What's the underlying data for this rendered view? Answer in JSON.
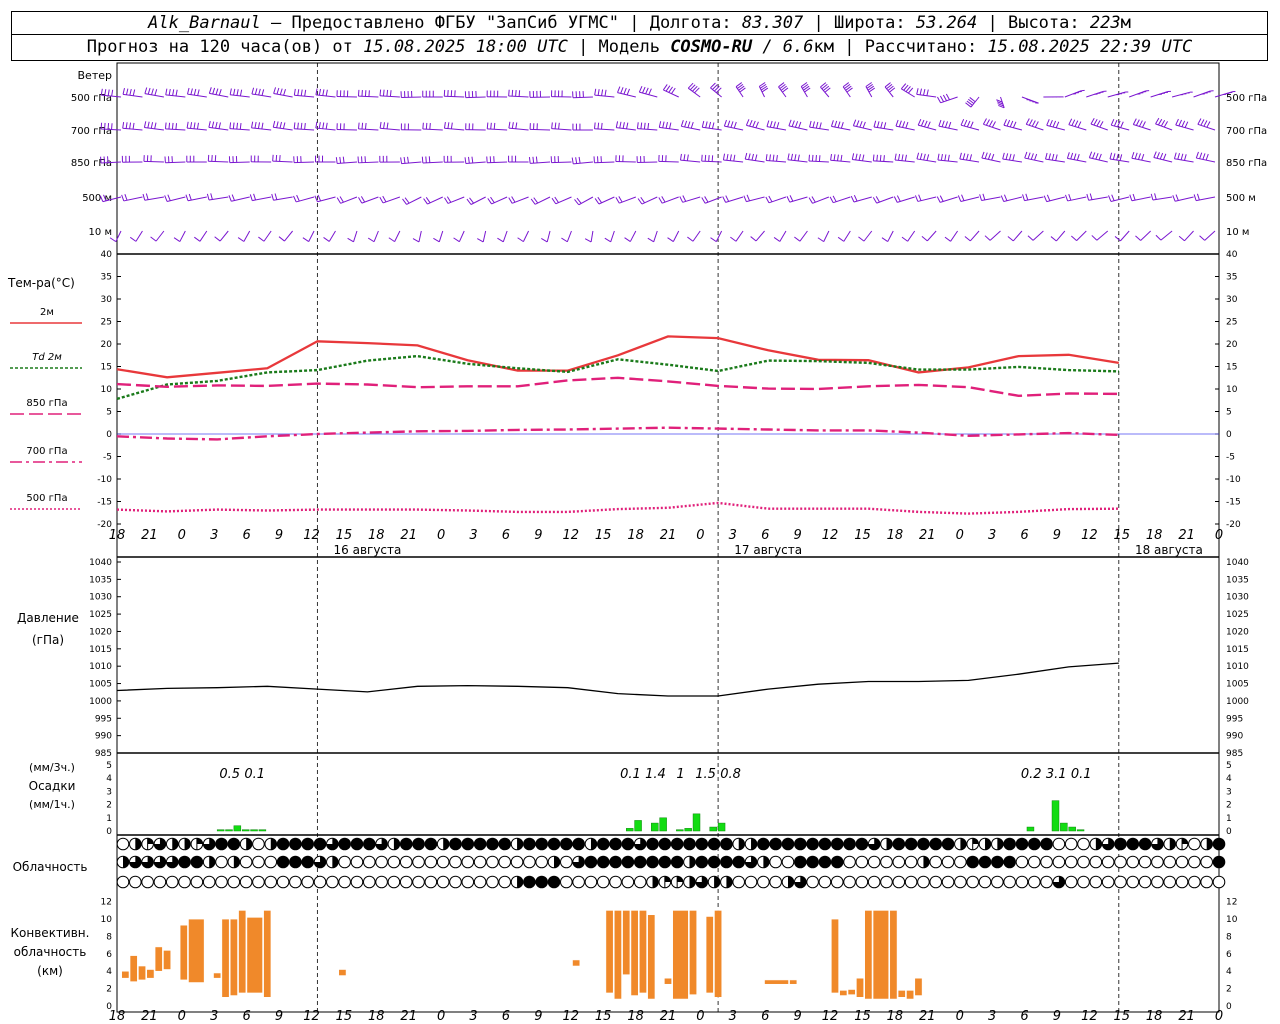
{
  "header": {
    "line1": {
      "station": "Alk_Barnaul",
      "dash": " — ",
      "provider": "Предоставлено ФГБУ \"ЗапСиб УГМС\"",
      "lon_label": " | Долгота: ",
      "lon": "83.307",
      "lat_label": " | Широта: ",
      "lat": "53.264",
      "alt_label": " | Высота: ",
      "alt": "223",
      "alt_unit": "м"
    },
    "line2": {
      "fc_label": "Прогноз на 120 часа(ов) от ",
      "fc_time": "15.08.2025 18:00 UTC",
      "model_label": "  | Модель ",
      "model": "COSMO-RU",
      "model_res": " / 6.6",
      "model_unit": "км",
      "calc_label": " | Рассчитано: ",
      "calc_time": "15.08.2025 22:39 UTC"
    }
  },
  "chart_data": {
    "type": "meteogram",
    "time_ticks": [
      "18",
      "21",
      "0",
      "3",
      "6",
      "9",
      "12",
      "15",
      "18",
      "21",
      "0",
      "3",
      "6",
      "9",
      "12",
      "15",
      "18",
      "21",
      "0",
      "3",
      "6",
      "9",
      "12",
      "15",
      "18",
      "21",
      "0",
      "3",
      "6",
      "9",
      "12",
      "15",
      "18",
      "21",
      "0"
    ],
    "day_labels": [
      {
        "label": "16 августа",
        "at_hours": 30
      },
      {
        "label": "17 августа",
        "at_hours": 78
      },
      {
        "label": "18 августа",
        "at_hours": 126
      }
    ],
    "wind": {
      "title": "Ветер",
      "levels": [
        "500 гПа",
        "700 гПа",
        "850 гПа",
        "500 м",
        "10 м"
      ],
      "samples": [
        {
          "dir": [
            285,
            285,
            270,
            270,
            340,
            340,
            60,
            60
          ],
          "spd": [
            20,
            20,
            22,
            22,
            22,
            22,
            22,
            22
          ]
        },
        {
          "dir": [
            280,
            280,
            275,
            275,
            290,
            290,
            300,
            300
          ],
          "spd": [
            18,
            18,
            17,
            17,
            20,
            20,
            23,
            23
          ]
        },
        {
          "dir": [
            270,
            270,
            265,
            265,
            280,
            280,
            290,
            290
          ],
          "spd": [
            17,
            17,
            16,
            16,
            18,
            18,
            20,
            20
          ]
        },
        {
          "dir": [
            250,
            250,
            230,
            230,
            240,
            240,
            250,
            250
          ],
          "spd": [
            10,
            10,
            9,
            9,
            9,
            9,
            10,
            10
          ]
        },
        {
          "dir": [
            200,
            200,
            190,
            190,
            200,
            200,
            210,
            210
          ],
          "spd": [
            5,
            5,
            5,
            5,
            5,
            5,
            5,
            5
          ]
        }
      ]
    },
    "temperature": {
      "title": "Тем-ра(°C)",
      "ylim": [
        -20,
        40
      ],
      "ticks": [
        -20,
        -15,
        -10,
        -5,
        0,
        5,
        10,
        15,
        20,
        25,
        30,
        35,
        40
      ],
      "hours": [
        0,
        6,
        12,
        18,
        24,
        30,
        36,
        42,
        48,
        54,
        60,
        66,
        72,
        78,
        84,
        90,
        96,
        102,
        108,
        114,
        120
      ],
      "series": [
        {
          "name": "2м",
          "color": "#e8383b",
          "style": "solid",
          "values": [
            14.4,
            12.6,
            13.6,
            14.6,
            20.6,
            20.2,
            19.7,
            16.4,
            14.1,
            14.1,
            17.5,
            21.7,
            21.3,
            18.6,
            16.5,
            16.4,
            13.7,
            14.8,
            17.3,
            17.6,
            15.8
          ]
        },
        {
          "name": "Td 2м",
          "color": "#1a7a1a",
          "style": "short-dash",
          "values": [
            7.8,
            11.0,
            11.8,
            13.7,
            14.2,
            16.3,
            17.3,
            15.6,
            14.6,
            13.8,
            16.6,
            15.4,
            14.0,
            16.3,
            16.2,
            15.8,
            14.3,
            14.3,
            14.9,
            14.2,
            13.9
          ]
        },
        {
          "name": "850 гПа",
          "color": "#e0207a",
          "style": "long-dash",
          "values": [
            11.1,
            10.5,
            10.8,
            10.7,
            11.2,
            11.0,
            10.4,
            10.6,
            10.6,
            11.9,
            12.5,
            11.7,
            10.7,
            10.1,
            10.0,
            10.6,
            10.9,
            10.4,
            8.5,
            9.0,
            8.9
          ]
        },
        {
          "name": "700 гПа",
          "color": "#e0207a",
          "style": "dash-dot",
          "values": [
            -0.5,
            -1.0,
            -1.2,
            -0.5,
            0.0,
            0.3,
            0.6,
            0.7,
            0.9,
            1.0,
            1.2,
            1.4,
            1.2,
            1.0,
            0.8,
            0.8,
            0.3,
            -0.4,
            -0.1,
            0.2,
            -0.2
          ]
        },
        {
          "name": "500 гПа",
          "color": "#e0207a",
          "style": "dotted",
          "values": [
            -16.8,
            -17.2,
            -16.8,
            -17.0,
            -16.8,
            -16.8,
            -16.8,
            -17.0,
            -17.3,
            -17.3,
            -16.7,
            -16.4,
            -15.3,
            -16.6,
            -16.6,
            -16.6,
            -17.3,
            -17.7,
            -17.3,
            -16.7,
            -16.6
          ]
        }
      ]
    },
    "pressure": {
      "title": "Давление",
      "unit": "(гПа)",
      "ylim": [
        985,
        1040
      ],
      "ticks": [
        985,
        990,
        995,
        1000,
        1005,
        1010,
        1015,
        1020,
        1025,
        1030,
        1035,
        1040
      ],
      "hours": [
        0,
        6,
        12,
        18,
        24,
        30,
        36,
        42,
        48,
        54,
        60,
        66,
        72,
        78,
        84,
        90,
        96,
        102,
        108,
        114,
        120
      ],
      "values": [
        1003.0,
        1003.6,
        1003.8,
        1004.2,
        1003.4,
        1002.6,
        1004.2,
        1004.4,
        1004.2,
        1003.8,
        1002.1,
        1001.4,
        1001.4,
        1003.4,
        1004.8,
        1005.6,
        1005.6,
        1005.9,
        1007.7,
        1009.8,
        1010.9
      ]
    },
    "precipitation": {
      "title": "Осадки",
      "unit_top": "(мм/3ч.)",
      "unit_bottom": "(мм/1ч.)",
      "ylim": [
        0,
        5
      ],
      "ticks": [
        0,
        1,
        2,
        3,
        4,
        5
      ],
      "color": "#12dc12",
      "amounts_3h": [
        {
          "hours": 13.5,
          "label": "0.5"
        },
        {
          "hours": 16.5,
          "label": "0.1"
        },
        {
          "hours": 61.5,
          "label": "0.1"
        },
        {
          "hours": 64.5,
          "label": "1.4"
        },
        {
          "hours": 67.5,
          "label": "1"
        },
        {
          "hours": 70.5,
          "label": "1.5"
        },
        {
          "hours": 73.5,
          "label": "0.8"
        },
        {
          "hours": 109.5,
          "label": "0.2"
        },
        {
          "hours": 112.5,
          "label": "3.1"
        },
        {
          "hours": 115.5,
          "label": "0.1"
        }
      ],
      "bars_1h": [
        {
          "hours": 12,
          "value": 0.1
        },
        {
          "hours": 13,
          "value": 0.1
        },
        {
          "hours": 14,
          "value": 0.4
        },
        {
          "hours": 15,
          "value": 0.1
        },
        {
          "hours": 16,
          "value": 0.1
        },
        {
          "hours": 17,
          "value": 0.1
        },
        {
          "hours": 61,
          "value": 0.2
        },
        {
          "hours": 62,
          "value": 0.8
        },
        {
          "hours": 64,
          "value": 0.6
        },
        {
          "hours": 65,
          "value": 1.0
        },
        {
          "hours": 67,
          "value": 0.1
        },
        {
          "hours": 68,
          "value": 0.2
        },
        {
          "hours": 69,
          "value": 1.3
        },
        {
          "hours": 71,
          "value": 0.3
        },
        {
          "hours": 72,
          "value": 0.6
        },
        {
          "hours": 109,
          "value": 0.3
        },
        {
          "hours": 112,
          "value": 2.3
        },
        {
          "hours": 113,
          "value": 0.6
        },
        {
          "hours": 114,
          "value": 0.3
        },
        {
          "hours": 115,
          "value": 0.1
        }
      ]
    },
    "cloudiness": {
      "title": "Облачность",
      "rows_octas": [
        [
          0,
          4,
          3,
          6,
          4,
          4,
          3,
          6,
          8,
          8,
          4,
          0,
          4,
          8,
          8,
          8,
          8,
          6,
          8,
          8,
          8,
          6,
          4,
          8,
          8,
          8,
          4,
          8,
          8,
          8,
          8,
          8,
          4,
          8,
          8,
          8,
          8,
          8,
          4,
          8,
          8,
          8,
          6,
          8,
          8,
          8,
          8,
          8,
          8,
          8,
          4,
          4,
          8,
          8,
          8,
          8,
          8,
          8,
          8,
          8,
          8,
          6,
          4,
          8,
          8,
          8,
          8,
          8,
          4,
          3,
          4,
          4,
          8,
          8,
          8,
          8,
          0,
          0,
          0,
          4,
          6,
          8,
          8,
          8,
          6,
          4,
          3,
          0,
          4,
          8
        ],
        [
          4,
          6,
          6,
          6,
          6,
          8,
          8,
          4,
          0,
          4,
          0,
          0,
          0,
          8,
          8,
          8,
          6,
          4,
          0,
          0,
          0,
          0,
          0,
          0,
          0,
          0,
          0,
          0,
          0,
          0,
          0,
          0,
          0,
          0,
          0,
          4,
          0,
          6,
          8,
          8,
          8,
          8,
          8,
          8,
          8,
          8,
          4,
          8,
          8,
          8,
          8,
          6,
          4,
          0,
          0,
          8,
          8,
          8,
          8,
          0,
          0,
          0,
          0,
          0,
          0,
          4,
          0,
          0,
          0,
          8,
          8,
          8,
          8,
          0,
          0,
          0,
          0,
          0,
          0,
          0,
          0,
          0,
          0,
          0,
          0,
          0,
          0,
          0,
          0,
          8
        ],
        [
          0,
          0,
          0,
          0,
          0,
          0,
          0,
          0,
          0,
          0,
          0,
          0,
          0,
          0,
          0,
          0,
          0,
          0,
          0,
          0,
          0,
          0,
          0,
          0,
          0,
          0,
          0,
          0,
          0,
          0,
          0,
          0,
          4,
          8,
          8,
          8,
          0,
          0,
          0,
          0,
          0,
          0,
          0,
          4,
          3,
          3,
          4,
          6,
          4,
          4,
          0,
          0,
          0,
          0,
          4,
          6,
          0,
          0,
          0,
          0,
          0,
          0,
          0,
          0,
          0,
          0,
          0,
          0,
          0,
          0,
          0,
          0,
          0,
          0,
          0,
          0,
          6,
          0,
          0,
          0,
          0,
          0,
          0,
          0,
          0,
          0,
          0,
          0,
          0,
          0
        ]
      ]
    },
    "convective": {
      "title_lines": [
        "Конвективн.",
        "облачность",
        "(км)"
      ],
      "ylim": [
        0,
        13
      ],
      "ticks": [
        0,
        2,
        4,
        6,
        8,
        10,
        12
      ],
      "color": "#f0892a",
      "bars": [
        {
          "h0": 0.5,
          "h1": 1.5,
          "base": 3.2,
          "top": 4.0
        },
        {
          "h0": 1.5,
          "h1": 2.5,
          "base": 2.8,
          "top": 5.8
        },
        {
          "h0": 2.5,
          "h1": 3.5,
          "base": 3.0,
          "top": 4.6
        },
        {
          "h0": 3.5,
          "h1": 4.5,
          "base": 3.2,
          "top": 4.2
        },
        {
          "h0": 4.5,
          "h1": 5.5,
          "base": 4.0,
          "top": 6.8
        },
        {
          "h0": 5.5,
          "h1": 6.5,
          "base": 4.2,
          "top": 6.4
        },
        {
          "h0": 7.5,
          "h1": 8.5,
          "base": 3.0,
          "top": 9.3
        },
        {
          "h0": 8.5,
          "h1": 10.5,
          "base": 2.7,
          "top": 10.0
        },
        {
          "h0": 11.5,
          "h1": 12.5,
          "base": 3.2,
          "top": 3.8
        },
        {
          "h0": 12.5,
          "h1": 13.5,
          "base": 1.0,
          "top": 10.0
        },
        {
          "h0": 13.5,
          "h1": 14.5,
          "base": 1.2,
          "top": 10.0
        },
        {
          "h0": 14.5,
          "h1": 15.5,
          "base": 1.5,
          "top": 11.0
        },
        {
          "h0": 15.5,
          "h1": 17.5,
          "base": 1.5,
          "top": 10.2
        },
        {
          "h0": 17.5,
          "h1": 18.5,
          "base": 1.0,
          "top": 11.0
        },
        {
          "h0": 26.5,
          "h1": 27.5,
          "base": 3.5,
          "top": 4.2
        },
        {
          "h0": 54.5,
          "h1": 55.5,
          "base": 4.6,
          "top": 5.3
        },
        {
          "h0": 58.5,
          "h1": 59.5,
          "base": 1.5,
          "top": 11.0
        },
        {
          "h0": 59.5,
          "h1": 60.5,
          "base": 0.8,
          "top": 11.0
        },
        {
          "h0": 60.5,
          "h1": 61.5,
          "base": 3.6,
          "top": 11.0
        },
        {
          "h0": 61.5,
          "h1": 62.5,
          "base": 1.2,
          "top": 11.0
        },
        {
          "h0": 62.5,
          "h1": 63.5,
          "base": 1.5,
          "top": 11.0
        },
        {
          "h0": 63.5,
          "h1": 64.5,
          "base": 0.8,
          "top": 10.5
        },
        {
          "h0": 65.5,
          "h1": 66.5,
          "base": 2.5,
          "top": 3.2
        },
        {
          "h0": 66.5,
          "h1": 68.5,
          "base": 0.8,
          "top": 11.0
        },
        {
          "h0": 68.5,
          "h1": 69.5,
          "base": 1.3,
          "top": 11.0
        },
        {
          "h0": 70.5,
          "h1": 71.5,
          "base": 1.5,
          "top": 10.3
        },
        {
          "h0": 71.5,
          "h1": 72.5,
          "base": 1.0,
          "top": 11.0
        },
        {
          "h0": 77.5,
          "h1": 80.5,
          "base": 2.5,
          "top": 3.0
        },
        {
          "h0": 80.5,
          "h1": 81.5,
          "base": 2.5,
          "top": 3.0
        },
        {
          "h0": 85.5,
          "h1": 86.5,
          "base": 1.5,
          "top": 10.0
        },
        {
          "h0": 86.5,
          "h1": 87.5,
          "base": 1.2,
          "top": 1.8
        },
        {
          "h0": 87.5,
          "h1": 88.5,
          "base": 1.3,
          "top": 1.9
        },
        {
          "h0": 88.5,
          "h1": 89.5,
          "base": 1.0,
          "top": 3.2
        },
        {
          "h0": 89.5,
          "h1": 90.5,
          "base": 0.8,
          "top": 11.0
        },
        {
          "h0": 90.5,
          "h1": 92.5,
          "base": 0.8,
          "top": 11.0
        },
        {
          "h0": 92.5,
          "h1": 93.5,
          "base": 0.8,
          "top": 11.0
        },
        {
          "h0": 93.5,
          "h1": 94.5,
          "base": 1.0,
          "top": 1.8
        },
        {
          "h0": 94.5,
          "h1": 95.5,
          "base": 0.8,
          "top": 1.8
        },
        {
          "h0": 95.5,
          "h1": 96.5,
          "base": 1.2,
          "top": 3.2
        }
      ]
    }
  }
}
